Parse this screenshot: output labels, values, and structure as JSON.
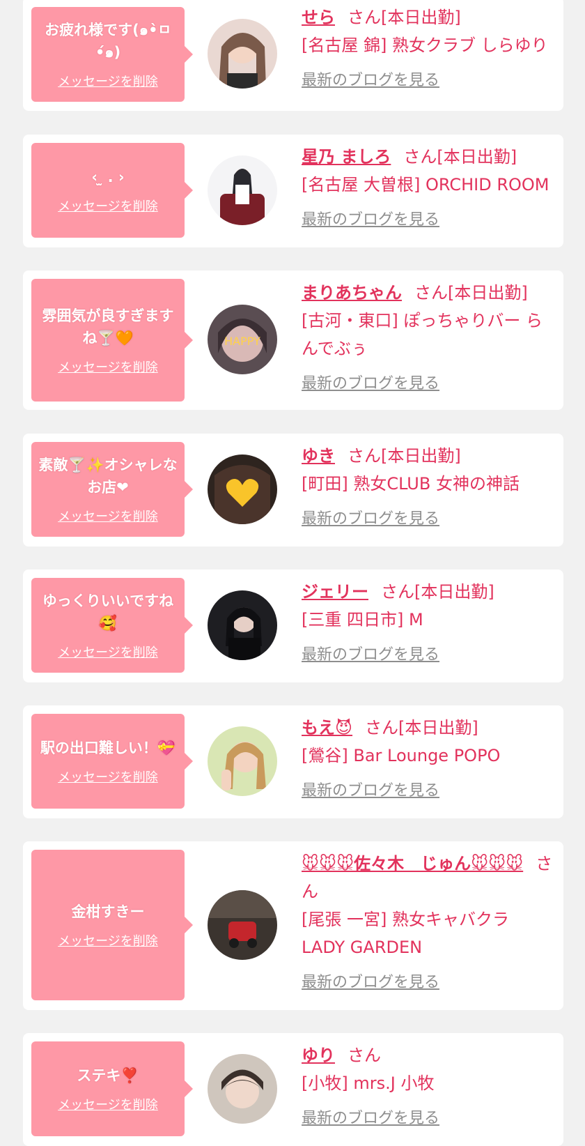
{
  "colors": {
    "accent": "#e2325c",
    "bubble": "#fe98a6",
    "link_gray": "#8e8e8e",
    "bg": "#f1f1f1"
  },
  "labels": {
    "delete": "メッセージを削除",
    "blog": "最新のブログを見る"
  },
  "cards": [
    {
      "message": "お疲れ様です(๑•̀ㅁ•́๑)",
      "name": "せら",
      "suffix": "さん[本日出勤]",
      "shop": "[名古屋 錦] 熟女クラブ しらゆり"
    },
    {
      "message": "‹ ̫ . ›",
      "name": "星乃 ましろ",
      "suffix": "さん[本日出勤]",
      "shop": "[名古屋 大曽根] ORCHID ROOM"
    },
    {
      "message": "雰囲気が良すぎますね🍸🧡",
      "name": "まりあちゃん",
      "suffix": "さん[本日出勤]",
      "shop": "[古河・東口] ぽっちゃりバー らんでぶぅ"
    },
    {
      "message": "素敵🍸✨オシャレなお店❤",
      "name": "ゆき",
      "suffix": "さん[本日出勤]",
      "shop": "[町田] 熟女CLUB 女神の神話"
    },
    {
      "message": "ゆっくりいいですね🥰",
      "name": "ジェリー",
      "suffix": "さん[本日出勤]",
      "shop": "[三重 四日市] M"
    },
    {
      "message": "駅の出口難しい！💝",
      "name": "もえ😈",
      "suffix": "さん[本日出勤]",
      "shop": "[鶯谷] Bar Lounge POPO"
    },
    {
      "message": "金柑すきー",
      "name": "🐭🐭🐭佐々木　じゅん🐭🐭🐭",
      "suffix": "さん",
      "shop": "[尾張 一宮] 熟女キャバクラ LADY GARDEN"
    },
    {
      "message": "ステキ❣️",
      "name": "ゆり",
      "suffix": "さん",
      "shop": "[小牧] mrs.J 小牧"
    }
  ]
}
